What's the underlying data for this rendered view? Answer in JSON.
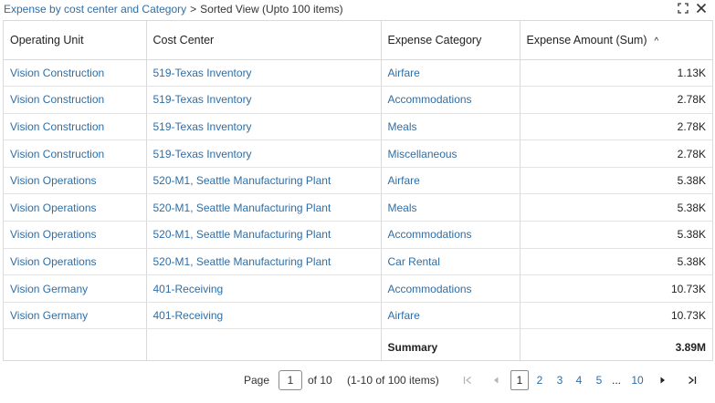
{
  "breadcrumb": {
    "parent": "Expense by cost center and Category",
    "separator": ">",
    "current": "Sorted View (Upto 100 items)"
  },
  "header_icons": [
    "expand-icon",
    "close-icon"
  ],
  "table": {
    "columns": [
      "Operating Unit",
      "Cost Center",
      "Expense Category",
      "Expense Amount (Sum)"
    ],
    "sort": {
      "column": "Expense Amount (Sum)",
      "direction": "ascending",
      "glyph": "^"
    },
    "rows": [
      [
        "Vision Construction",
        "519-Texas Inventory",
        "Airfare",
        "1.13K"
      ],
      [
        "Vision Construction",
        "519-Texas Inventory",
        "Accommodations",
        "2.78K"
      ],
      [
        "Vision Construction",
        "519-Texas Inventory",
        "Meals",
        "2.78K"
      ],
      [
        "Vision Construction",
        "519-Texas Inventory",
        "Miscellaneous",
        "2.78K"
      ],
      [
        "Vision Operations",
        "520-M1, Seattle Manufacturing Plant",
        "Airfare",
        "5.38K"
      ],
      [
        "Vision Operations",
        "520-M1, Seattle Manufacturing Plant",
        "Meals",
        "5.38K"
      ],
      [
        "Vision Operations",
        "520-M1, Seattle Manufacturing Plant",
        "Accommodations",
        "5.38K"
      ],
      [
        "Vision Operations",
        "520-M1, Seattle Manufacturing Plant",
        "Car Rental",
        "5.38K"
      ],
      [
        "Vision Germany",
        "401-Receiving",
        "Accommodations",
        "10.73K"
      ],
      [
        "Vision Germany",
        "401-Receiving",
        "Airfare",
        "10.73K"
      ]
    ],
    "summary": {
      "label": "Summary",
      "value": "3.89M"
    }
  },
  "pagination": {
    "page_label": "Page",
    "current_page": "1",
    "of_label": "of 10",
    "range_text": "(1-10 of 100 items)",
    "pages": [
      "1",
      "2",
      "3",
      "4",
      "5"
    ],
    "ellipsis": "...",
    "last_page": "10"
  },
  "colors": {
    "link": "#2f6ea6",
    "border": "#d9d9d9",
    "text": "#333333"
  }
}
